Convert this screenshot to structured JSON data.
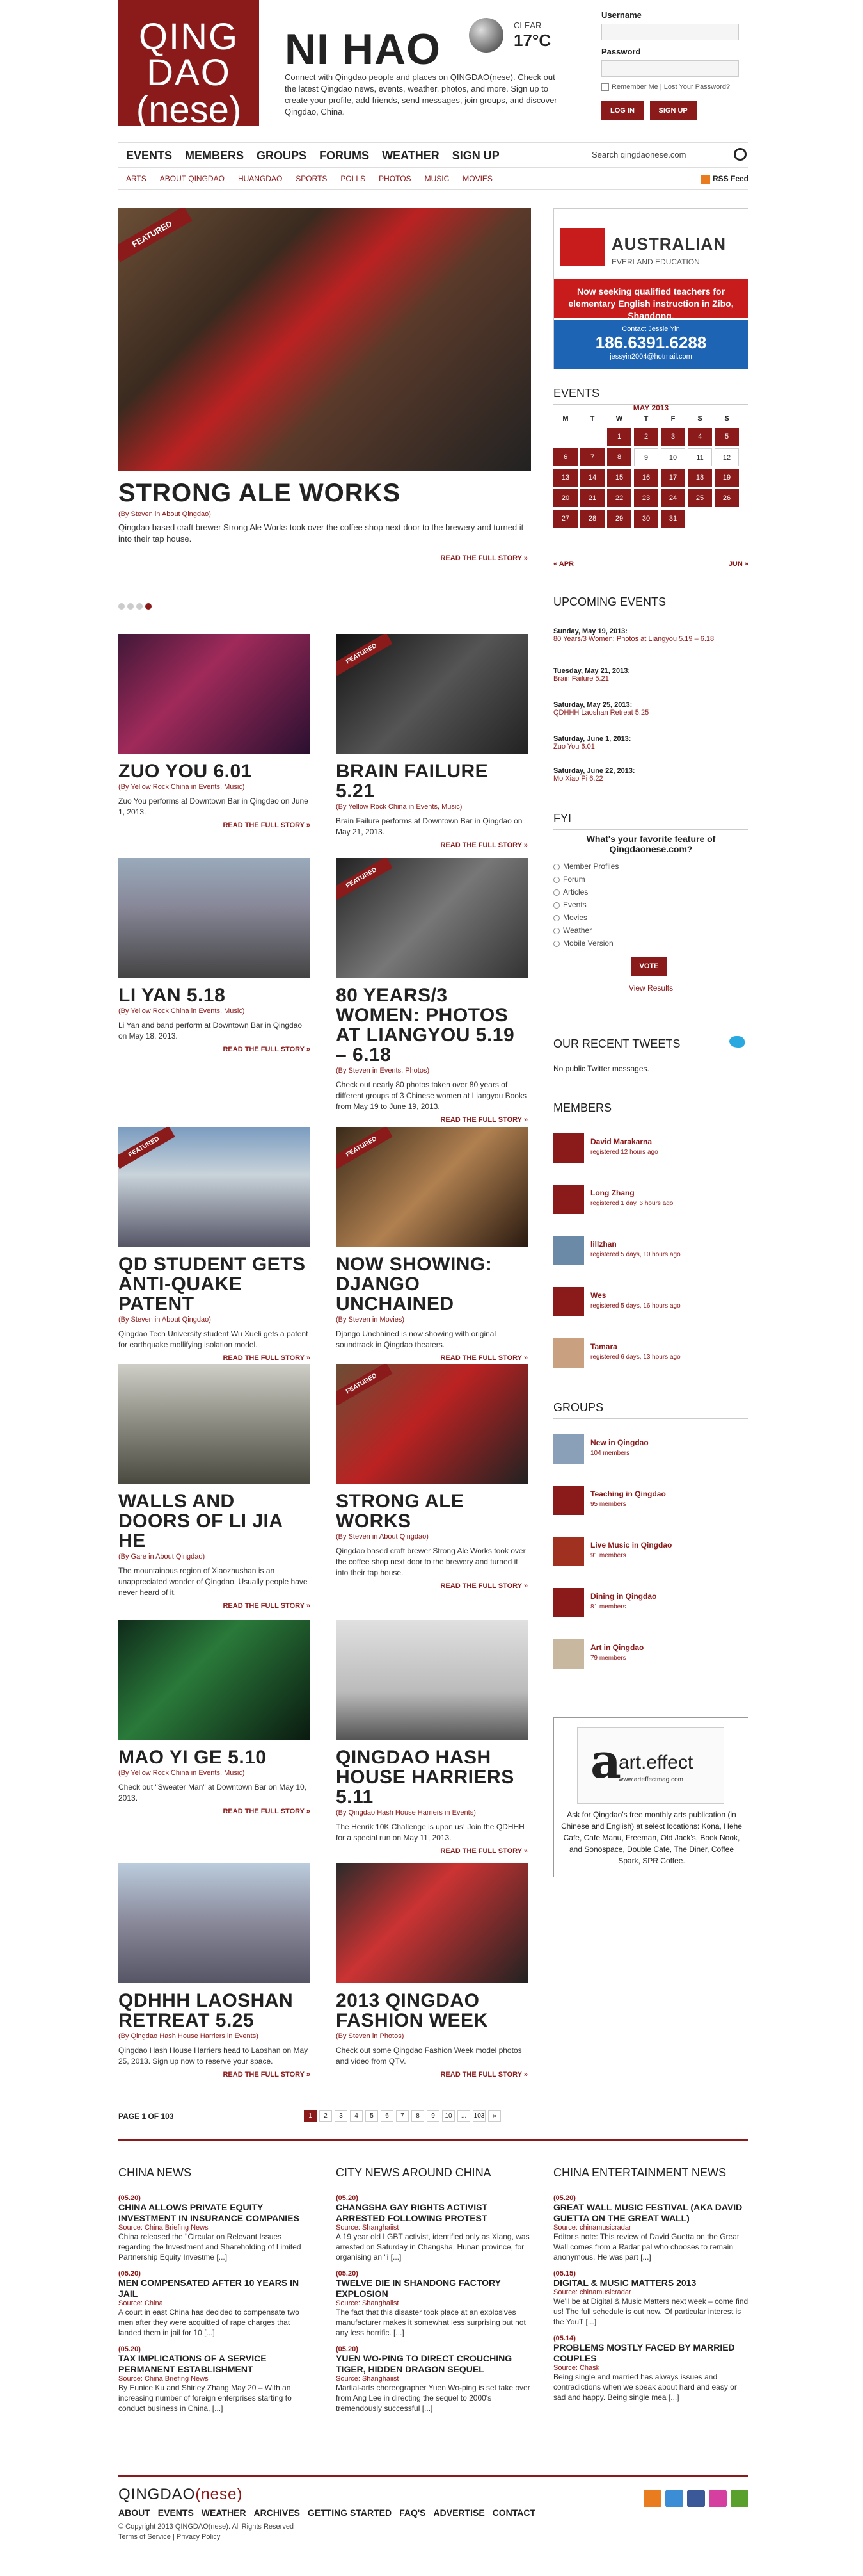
{
  "header": {
    "logo_line1": "QINGDAO",
    "logo_line2": "",
    "logo_line3": "(nese)",
    "greeting": "NI HAO",
    "weather_cond": "CLEAR",
    "weather_temp": "17°C",
    "intro_text": "Connect with Qingdao people and places on QINGDAO(nese). Check out the latest Qingdao news, events, weather, photos, and more. Sign up to create your profile, add friends, send messages, join groups, and discover Qingdao, China."
  },
  "login": {
    "username_label": "Username",
    "password_label": "Password",
    "remember_label": "Remember Me",
    "lost_password": "Lost Your Password?",
    "login_button": "LOG IN",
    "signup_button": "SIGN UP"
  },
  "nav": {
    "items": [
      "EVENTS",
      "MEMBERS",
      "GROUPS",
      "FORUMS",
      "WEATHER",
      "SIGN UP"
    ],
    "search_placeholder": "Search qingdaonese.com"
  },
  "subnav": {
    "items": [
      "ARTS",
      "ABOUT QINGDAO",
      "HUANGDAO",
      "SPORTS",
      "POLLS",
      "PHOTOS",
      "MUSIC",
      "MOVIES"
    ],
    "rss": "RSS Feed"
  },
  "featured": {
    "ribbon": "FEATURED",
    "title": "STRONG ALE WORKS",
    "byline": "(By Steven in About Qingdao)",
    "excerpt": "Qingdao based craft brewer Strong Ale Works took over the coffee shop next door to the brewery and turned it into their tap house.",
    "more": "READ THE FULL STORY »"
  },
  "cards": [
    {
      "title": "ZUO YOU 6.01",
      "byline": "(By Yellow Rock China in Events, Music)",
      "excerpt": "Zuo You performs at Downtown Bar in Qingdao on June 1, 2013.",
      "more": "READ THE FULL STORY »",
      "ribbon": ""
    },
    {
      "title": "BRAIN FAILURE 5.21",
      "byline": "(By Yellow Rock China in Events, Music)",
      "excerpt": "Brain Failure performs at Downtown Bar in Qingdao on May 21, 2013.",
      "more": "READ THE FULL STORY »",
      "ribbon": "FEATURED"
    },
    {
      "title": "LI YAN 5.18",
      "byline": "(By Yellow Rock China in Events, Music)",
      "excerpt": "Li Yan and band perform at Downtown Bar in Qingdao on May 18, 2013.",
      "more": "READ THE FULL STORY »",
      "ribbon": ""
    },
    {
      "title": "80 YEARS/3 WOMEN: PHOTOS AT LIANGYOU 5.19 – 6.18",
      "byline": "(By Steven in Events, Photos)",
      "excerpt": "Check out nearly 80 photos taken over 80 years of different groups of 3 Chinese women at Liangyou Books from May 19 to June 19, 2013.",
      "more": "READ THE FULL STORY »",
      "ribbon": "FEATURED"
    },
    {
      "title": "QD STUDENT GETS ANTI-QUAKE PATENT",
      "byline": "(By Steven in About Qingdao)",
      "excerpt": "Qingdao Tech University student Wu Xueli gets a patent for earthquake mollifying isolation model.",
      "more": "READ THE FULL STORY »",
      "ribbon": "FEATURED"
    },
    {
      "title": "NOW SHOWING: DJANGO UNCHAINED",
      "byline": "(By Steven in Movies)",
      "excerpt": "Django Unchained is now showing with original soundtrack in Qingdao theaters.",
      "more": "READ THE FULL STORY »",
      "ribbon": "FEATURED"
    },
    {
      "title": "WALLS AND DOORS OF LI JIA HE",
      "byline": "(By Gare in About Qingdao)",
      "excerpt": "The mountainous region of Xiaozhushan is an unappreciated wonder of Qingdao. Usually people have never heard of it.",
      "more": "READ THE FULL STORY »",
      "ribbon": ""
    },
    {
      "title": "STRONG ALE WORKS",
      "byline": "(By Steven in About Qingdao)",
      "excerpt": "Qingdao based craft brewer Strong Ale Works took over the coffee shop next door to the brewery and turned it into their tap house.",
      "more": "READ THE FULL STORY »",
      "ribbon": "FEATURED"
    },
    {
      "title": "MAO YI GE 5.10",
      "byline": "(By Yellow Rock China in Events, Music)",
      "excerpt": "Check out \"Sweater Man\" at Downtown Bar on May 10, 2013.",
      "more": "READ THE FULL STORY »",
      "ribbon": ""
    },
    {
      "title": "QINGDAO HASH HOUSE HARRIERS 5.11",
      "byline": "(By Qingdao Hash House Harriers in Events)",
      "excerpt": "The Henrik 10K Challenge is upon us! Join the QDHHH for a special run on May 11, 2013.",
      "more": "READ THE FULL STORY »",
      "ribbon": ""
    },
    {
      "title": "QDHHH LAOSHAN RETREAT 5.25",
      "byline": "(By Qingdao Hash House Harriers in Events)",
      "excerpt": "Qingdao Hash House Harriers head to Laoshan on May 25, 2013. Sign up now to reserve your space.",
      "more": "READ THE FULL STORY »",
      "ribbon": ""
    },
    {
      "title": "2013 QINGDAO FASHION WEEK",
      "byline": "(By Steven in Photos)",
      "excerpt": "Check out some Qingdao Fashion Week model photos and video from QTV.",
      "more": "READ THE FULL STORY »",
      "ribbon": ""
    }
  ],
  "ad": {
    "brand": "AUSTRALIAN",
    "brand_sub": "EVERLAND EDUCATION",
    "message": "Now seeking qualified teachers for elementary English instruction in Zibo, Shandong.",
    "contact": "Contact Jessie Yin",
    "phone": "186.6391.6288",
    "email": "jessyin2004@hotmail.com"
  },
  "events": {
    "heading": "EVENTS",
    "month": "MAY 2013",
    "weekdays": [
      "M",
      "T",
      "W",
      "T",
      "F",
      "S",
      "S"
    ],
    "prev": "« APR",
    "next": "JUN »"
  },
  "upcoming": {
    "heading": "UPCOMING EVENTS",
    "items": [
      {
        "date": "Sunday, May 19, 2013:",
        "event": "80 Years/3 Women: Photos at Liangyou 5.19 – 6.18"
      },
      {
        "date": "Tuesday, May 21, 2013:",
        "event": "Brain Failure 5.21"
      },
      {
        "date": "Saturday, May 25, 2013:",
        "event": "QDHHH Laoshan Retreat 5.25"
      },
      {
        "date": "Saturday, June 1, 2013:",
        "event": "Zuo You 6.01"
      },
      {
        "date": "Saturday, June 22, 2013:",
        "event": "Mo Xiao Pi 6.22"
      }
    ]
  },
  "fyi": {
    "heading": "FYI",
    "question": "What's your favorite feature of Qingdaonese.com?",
    "options": [
      "Member Profiles",
      "Forum",
      "Articles",
      "Events",
      "Movies",
      "Weather",
      "Mobile Version"
    ],
    "vote": "VOTE",
    "results": "View Results"
  },
  "tweets": {
    "heading": "OUR RECENT TWEETS",
    "text": "No public Twitter messages."
  },
  "members": {
    "heading": "MEMBERS",
    "items": [
      {
        "name": "David Marakarna",
        "meta": "registered 12 hours ago"
      },
      {
        "name": "Long Zhang",
        "meta": "registered 1 day, 6 hours ago"
      },
      {
        "name": "lillzhan",
        "meta": "registered 5 days, 10 hours ago"
      },
      {
        "name": "Wes",
        "meta": "registered 5 days, 16 hours ago"
      },
      {
        "name": "Tamara",
        "meta": "registered 6 days, 13 hours ago"
      }
    ]
  },
  "groups": {
    "heading": "GROUPS",
    "items": [
      {
        "name": "New in Qingdao",
        "meta": "104 members"
      },
      {
        "name": "Teaching in Qingdao",
        "meta": "95 members"
      },
      {
        "name": "Live Music in Qingdao",
        "meta": "91 members"
      },
      {
        "name": "Dining in Qingdao",
        "meta": "81 members"
      },
      {
        "name": "Art in Qingdao",
        "meta": "79 members"
      }
    ]
  },
  "artad": {
    "logo": "art.effect",
    "url": "www.arteffectmag.com",
    "text": "Ask for Qingdao's free monthly arts publication (in Chinese and English) at select locations: Kona, Hehe Cafe, Cafe Manu, Freeman, Old Jack's, Book Nook, and Sonospace, Double Cafe, The Diner, Coffee Spark, SPR Coffee."
  },
  "pager": {
    "label": "PAGE 1 OF 103",
    "pages": [
      "1",
      "2",
      "3",
      "4",
      "5",
      "6",
      "7",
      "8",
      "9",
      "10",
      "...",
      "103",
      "»"
    ]
  },
  "news": [
    {
      "heading": "CHINA NEWS",
      "items": [
        {
          "date": "(05.20)",
          "title": "China allows private equity investment in insurance companies",
          "source": "Source: China Briefing News",
          "text": "China released the \"Circular on Relevant Issues regarding the Investment and Shareholding of Limited Partnership Equity Investme [...]"
        },
        {
          "date": "(05.20)",
          "title": "Men compensated after 10 years in jail",
          "source": "Source: China",
          "text": "A court in east China has decided to compensate two men after they were acquitted of rape charges that landed them in jail for 10 [...]"
        },
        {
          "date": "(05.20)",
          "title": "Tax implications of a service permanent establishment",
          "source": "Source: China Briefing News",
          "text": "By Eunice Ku and Shirley Zhang May 20 – With an increasing number of foreign enterprises starting to conduct business in China, [...]"
        }
      ]
    },
    {
      "heading": "CITY NEWS AROUND CHINA",
      "items": [
        {
          "date": "(05.20)",
          "title": "Changsha gay rights activist arrested following protest",
          "source": "Source: Shanghaiist",
          "text": "A 19 year old LGBT activist, identified only as Xiang, was arrested on Saturday in Changsha, Hunan province, for organising an \"i [...]"
        },
        {
          "date": "(05.20)",
          "title": "Twelve die in Shandong factory explosion",
          "source": "Source: Shanghaiist",
          "text": "The fact that this disaster took place at an explosives manufacturer makes it somewhat less surprising but not any less horrific. [...]"
        },
        {
          "date": "(05.20)",
          "title": "Yuen Wo-Ping to direct Crouching Tiger, Hidden Dragon sequel",
          "source": "Source: Shanghaiist",
          "text": "Martial-arts choreographer Yuen Wo-ping is set take over from Ang Lee in directing the sequel to 2000's tremendously successful [...]"
        }
      ]
    },
    {
      "heading": "CHINA ENTERTAINMENT NEWS",
      "items": [
        {
          "date": "(05.20)",
          "title": "Great Wall Music Festival (aka David Guetta on the Great Wall)",
          "source": "Source: chinamusicradar",
          "text": "Editor's note: This review of David Guetta on the Great Wall comes from a Radar pal who chooses to remain anonymous. He was part [...]"
        },
        {
          "date": "(05.15)",
          "title": "Digital & Music Matters 2013",
          "source": "Source: chinamusicradar",
          "text": "We'll be at Digital & Music Matters next week – come find us! The full schedule is out now. Of particular interest is the YouT [...]"
        },
        {
          "date": "(05.14)",
          "title": "Problems mostly faced by married couples",
          "source": "Source: Chask",
          "text": "Being single and married has always issues and contradictions when we speak about hard and easy or sad and happy. Being single mea [...]"
        }
      ]
    }
  ],
  "footer": {
    "logo_a": "QINGDAO",
    "logo_b": "(nese)",
    "links": [
      "ABOUT",
      "EVENTS",
      "WEATHER",
      "ARCHIVES",
      "GETTING STARTED",
      "FAQ'S",
      "ADVERTISE",
      "CONTACT"
    ],
    "copyright": "© Copyright 2013 QINGDAO(nese). All Rights Reserved",
    "terms": "Terms of Service | Privacy Policy"
  },
  "colors": {
    "accent": "#8b1a1a"
  }
}
